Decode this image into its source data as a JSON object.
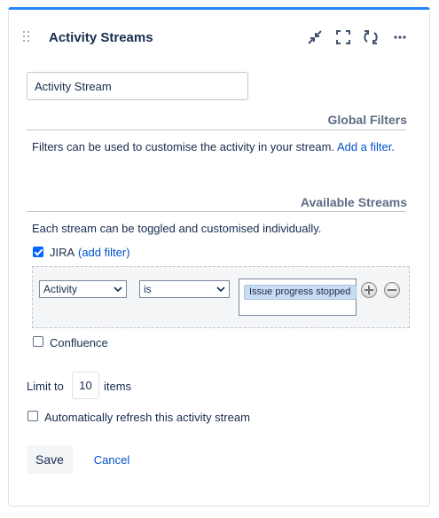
{
  "gadget": {
    "title": "Activity Streams",
    "accent_color": "#2684ff",
    "toolbar_icons": [
      "drag-handle-icon",
      "minimize-icon",
      "fullscreen-icon",
      "refresh-icon",
      "more-icon"
    ]
  },
  "name_field": {
    "value": "Activity Stream"
  },
  "global_filters": {
    "heading": "Global Filters",
    "description": "Filters can be used to customise the activity in your stream.",
    "add_link": "Add a filter",
    "after_link": "."
  },
  "available_streams": {
    "heading": "Available Streams",
    "description": "Each stream can be toggled and customised individually.",
    "jira": {
      "label": "JIRA",
      "checked": true,
      "add_filter_link": "(add filter)",
      "filter": {
        "field": "Activity",
        "operator": "is",
        "selected_value": "Issue progress stopped"
      }
    },
    "confluence": {
      "label": "Confluence",
      "checked": false
    }
  },
  "limit": {
    "prefix": "Limit to",
    "value": "10",
    "suffix": "items"
  },
  "auto_refresh": {
    "label": "Automatically refresh this activity stream",
    "checked": false
  },
  "actions": {
    "save": "Save",
    "cancel": "Cancel"
  }
}
